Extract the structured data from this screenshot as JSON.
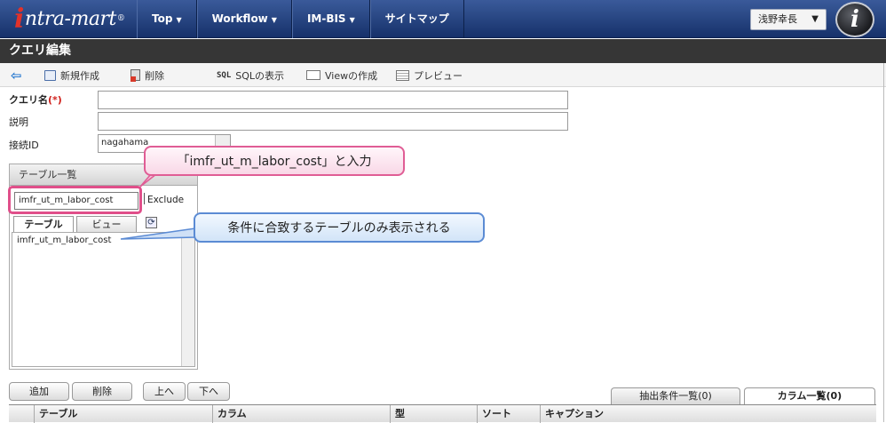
{
  "brand": {
    "logo_main": "ntra-mart",
    "logo_i": "i",
    "logo_reg": "®"
  },
  "nav": {
    "items": [
      {
        "label": "Top",
        "caret": "▼"
      },
      {
        "label": "Workflow",
        "caret": "▼"
      },
      {
        "label": "IM-BIS",
        "caret": "▼"
      },
      {
        "label": "サイトマップ",
        "caret": ""
      }
    ]
  },
  "user": {
    "name": "浅野幸長",
    "caret": "▼",
    "badge": "i"
  },
  "page": {
    "title": "クエリ編集"
  },
  "toolbar": {
    "new_label": "新規作成",
    "delete_label": "削除",
    "sql_prefix": "SQL",
    "sql_label": "SQLの表示",
    "view_label": "Viewの作成",
    "preview_label": "プレビュー"
  },
  "form": {
    "query_name_label": "クエリ名",
    "required_mark": "(*)",
    "query_name_value": "",
    "description_label": "説明",
    "description_value": "",
    "connection_label": "接続ID",
    "connection_value": "nagahama"
  },
  "table_list": {
    "title": "テーブル一覧",
    "filter_value": "imfr_ut_m_labor_cost",
    "exclude_label": "Exclude",
    "tabs": [
      "テーブル",
      "ビュー"
    ],
    "refresh_glyph": "⟳",
    "items": [
      "imfr_ut_m_labor_cost"
    ]
  },
  "callouts": {
    "input_hint": "「imfr_ut_m_labor_cost」と入力",
    "result_hint": "条件に合致するテーブルのみ表示される"
  },
  "bottom": {
    "buttons": [
      "追加",
      "削除",
      "上へ",
      "下へ"
    ],
    "tabs": [
      "抽出条件一覧(0)",
      "カラム一覧(0)"
    ],
    "columns": [
      "テーブル",
      "カラム",
      "型",
      "ソート",
      "キャプション"
    ]
  },
  "colors": {
    "nav_bg": "#1f3f7f",
    "title_bg": "#363636",
    "required": "#d0211c",
    "callout_pink": "#e05d95",
    "callout_blue": "#5b8bd4"
  }
}
